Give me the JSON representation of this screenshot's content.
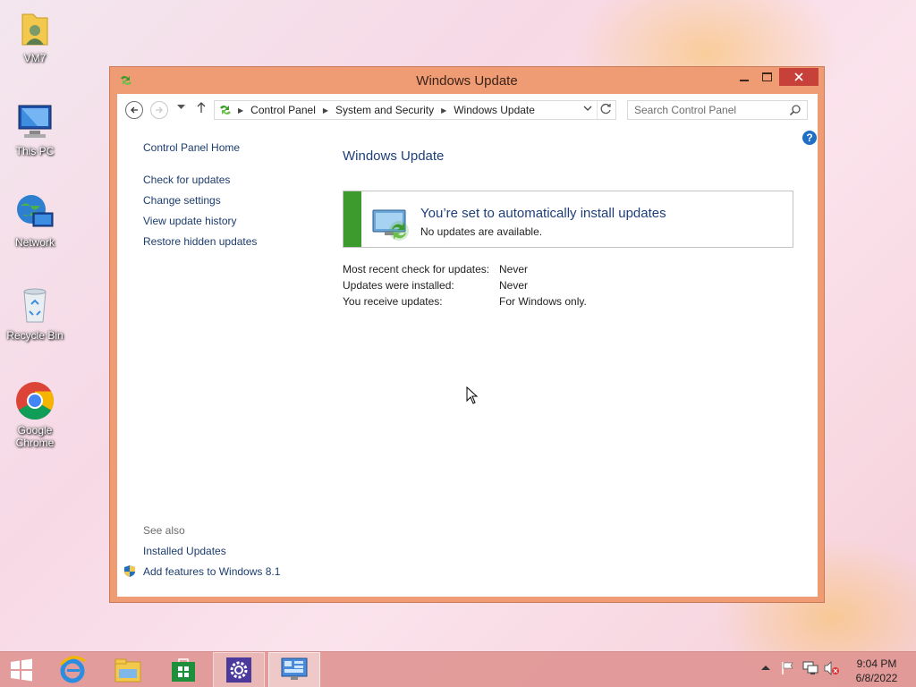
{
  "desktop": {
    "icons": [
      {
        "label": "VM7"
      },
      {
        "label": "This PC"
      },
      {
        "label": "Network"
      },
      {
        "label": "Recycle Bin"
      },
      {
        "label": "Google Chrome"
      }
    ]
  },
  "window": {
    "title": "Windows Update",
    "address": {
      "crumbs": [
        "Control Panel",
        "System and Security",
        "Windows Update"
      ]
    },
    "search": {
      "placeholder": "Search Control Panel"
    },
    "left_pane": {
      "home": "Control Panel Home",
      "links": [
        "Check for updates",
        "Change settings",
        "View update history",
        "Restore hidden updates"
      ],
      "see_also_label": "See also",
      "see_also_links": [
        "Installed Updates",
        "Add features to Windows 8.1"
      ]
    },
    "main": {
      "title": "Windows Update",
      "status_heading": "You’re set to automatically install updates",
      "status_sub": "No updates are available.",
      "info": [
        {
          "label": "Most recent check for updates:",
          "value": "Never"
        },
        {
          "label": "Updates were installed:",
          "value": "Never"
        },
        {
          "label": "You receive updates:",
          "value": "For Windows only."
        }
      ]
    }
  },
  "taskbar": {
    "clock_time": "9:04 PM",
    "clock_date": "6/8/2022"
  },
  "colors": {
    "window_frame": "#ef9b74",
    "link": "#1c3c6e",
    "heading": "#1e3f7a",
    "status_green": "#3c9b2c",
    "close_button": "#c7403a"
  }
}
